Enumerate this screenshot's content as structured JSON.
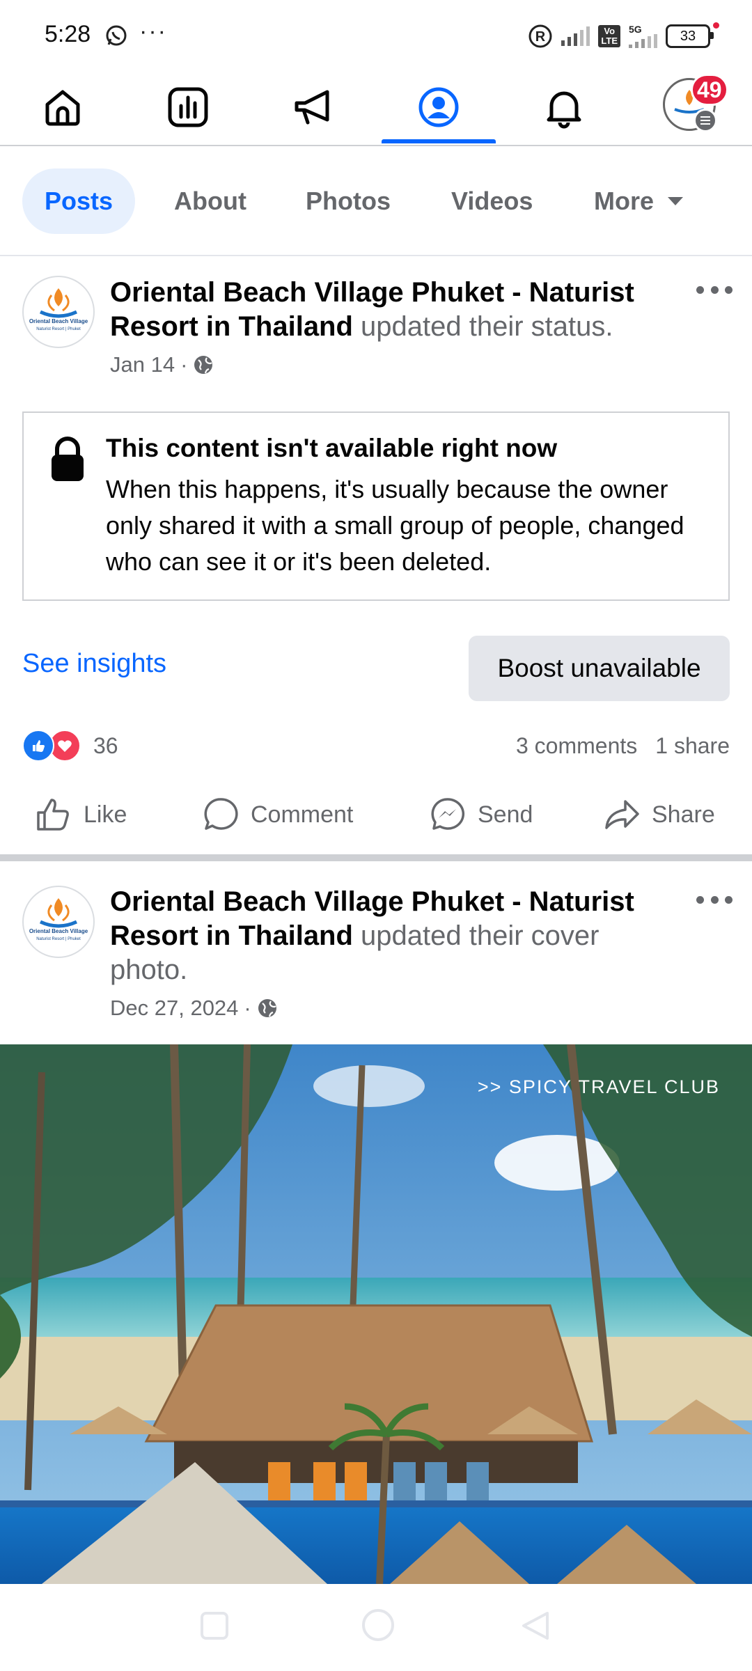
{
  "status_bar": {
    "time": "5:28",
    "dots": "···",
    "network": "5G",
    "volte": "Vo\nLTE",
    "battery": "33"
  },
  "nav": {
    "icons": [
      "home-icon",
      "dashboard-icon",
      "megaphone-icon",
      "profile-icon",
      "bell-icon",
      "menu-avatar-icon"
    ],
    "notification_count": "49",
    "active_color": "#0866ff"
  },
  "tabs": {
    "posts": "Posts",
    "about": "About",
    "photos": "Photos",
    "videos": "Videos",
    "more": "More"
  },
  "post1": {
    "page_name": "Oriental Beach Village Phuket - Naturist Resort in Thailand",
    "action": " updated their status.",
    "date": "Jan 14",
    "separator": "·",
    "unavailable_title": "This content isn't available right now",
    "unavailable_body": "When this happens, it's usually because the owner only shared it with a small group of people, changed who can see it or it's been deleted.",
    "see_insights": "See insights",
    "boost": "Boost unavailable",
    "reaction_count": "36",
    "comments": "3 comments",
    "shares": "1 share"
  },
  "actions": {
    "like": "Like",
    "comment": "Comment",
    "send": "Send",
    "share": "Share"
  },
  "post2": {
    "page_name": "Oriental Beach Village Phuket - Naturist Resort in Thailand",
    "action": " updated their cover photo.",
    "date": "Dec 27, 2024",
    "separator": "·",
    "photo_caption": ">> SPICY TRAVEL CLUB"
  },
  "logo": {
    "line1": "Oriental Beach Village",
    "line2": "Naturist Resort | Phuket"
  }
}
